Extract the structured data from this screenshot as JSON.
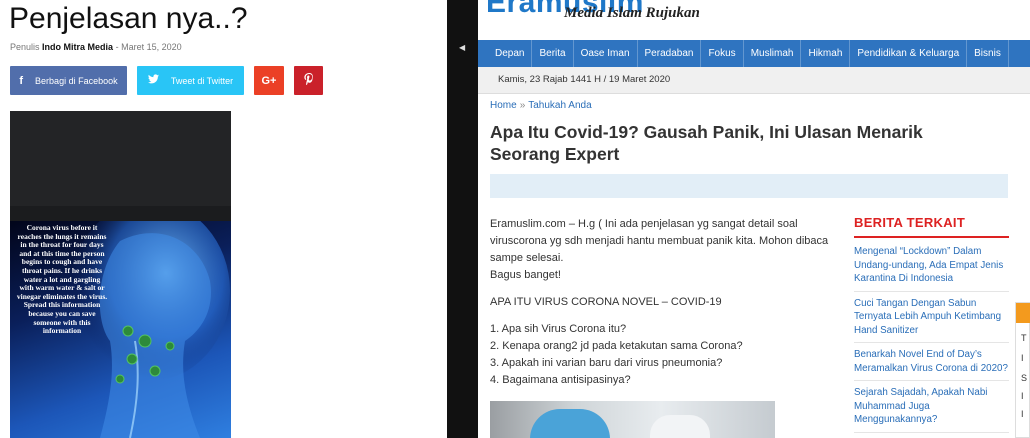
{
  "left": {
    "title": "Penjelasan nya..?",
    "meta": {
      "prefix": "Penulis",
      "author": "Indo Mitra Media",
      "separator": "-",
      "date": "Maret 15, 2020"
    },
    "share": {
      "facebook": {
        "icon": "facebook-icon",
        "glyph": "f",
        "label": "Berbagi di Facebook"
      },
      "twitter": {
        "icon": "twitter-icon",
        "glyph": "🐦",
        "label": "Tweet di Twitter"
      },
      "googleplus": {
        "icon": "google-plus-icon",
        "glyph": "G+"
      },
      "pinterest": {
        "icon": "pinterest-icon",
        "glyph": "P"
      }
    },
    "image_caption": "Corona virus before it reaches the lungs it remains in the throat for four days and at this time the person begins to cough and have throat pains. If he drinks water a lot and gargling with warm water & salt or vinegar eliminates the virus. Spread this information because you can save someone with this information"
  },
  "right": {
    "logo_text": "Eramuslim",
    "tagline": "Media Islam Rujukan",
    "nav": [
      "Depan",
      "Berita",
      "Oase Iman",
      "Peradaban",
      "Fokus",
      "Muslimah",
      "Hikmah",
      "Pendidikan & Keluarga",
      "Bisnis"
    ],
    "date": "Kamis, 23 Rajab 1441 H / 19 Maret 2020",
    "breadcrumb": {
      "home": "Home",
      "sep": "»",
      "section": "Tahukah Anda"
    },
    "article_title": "Apa Itu Covid-19? Gausah Panik, Ini Ulasan Menarik Seorang Expert",
    "body": {
      "intro": "Eramuslim.com – H.g ( Ini ada penjelasan yg sangat detail soal viruscorona yg sdh menjadi hantu membuat panik kita. Mohon dibaca sampe selesai.",
      "intro2": "Bagus banget!",
      "heading": "APA ITU VIRUS CORONA NOVEL – COVID-19",
      "list": [
        "1. Apa sih Virus Corona itu?",
        "2. Kenapa orang2 jd pada ketakutan sama Corona?",
        "3. Apakah ini varian baru dari virus pneumonia?",
        "4. Bagaimana antisipasinya?"
      ]
    },
    "sidebar": {
      "heading": "BERITA TERKAIT",
      "items": [
        "Mengenal “Lockdown” Dalam Undang-undang, Ada Empat Jenis Karantina Di Indonesia",
        "Cuci Tangan Dengan Sabun Ternyata Lebih Ampuh Ketimbang Hand Sanitizer",
        "Benarkah Novel End of Day’s Meramalkan Virus Corona di 2020?",
        "Sejarah Sajadah, Apakah Nabi Muhammad Juga Menggunakannya?"
      ]
    },
    "edge_letters": [
      "T",
      "I",
      "S",
      "I",
      "I"
    ]
  },
  "colors": {
    "facebook": "#516eab",
    "twitter": "#29c5f6",
    "googleplus": "#eb4026",
    "pinterest": "#ca212a",
    "nav": "#2f74c0",
    "sidebar_heading": "#dd2222",
    "link": "#2a6eb8"
  }
}
